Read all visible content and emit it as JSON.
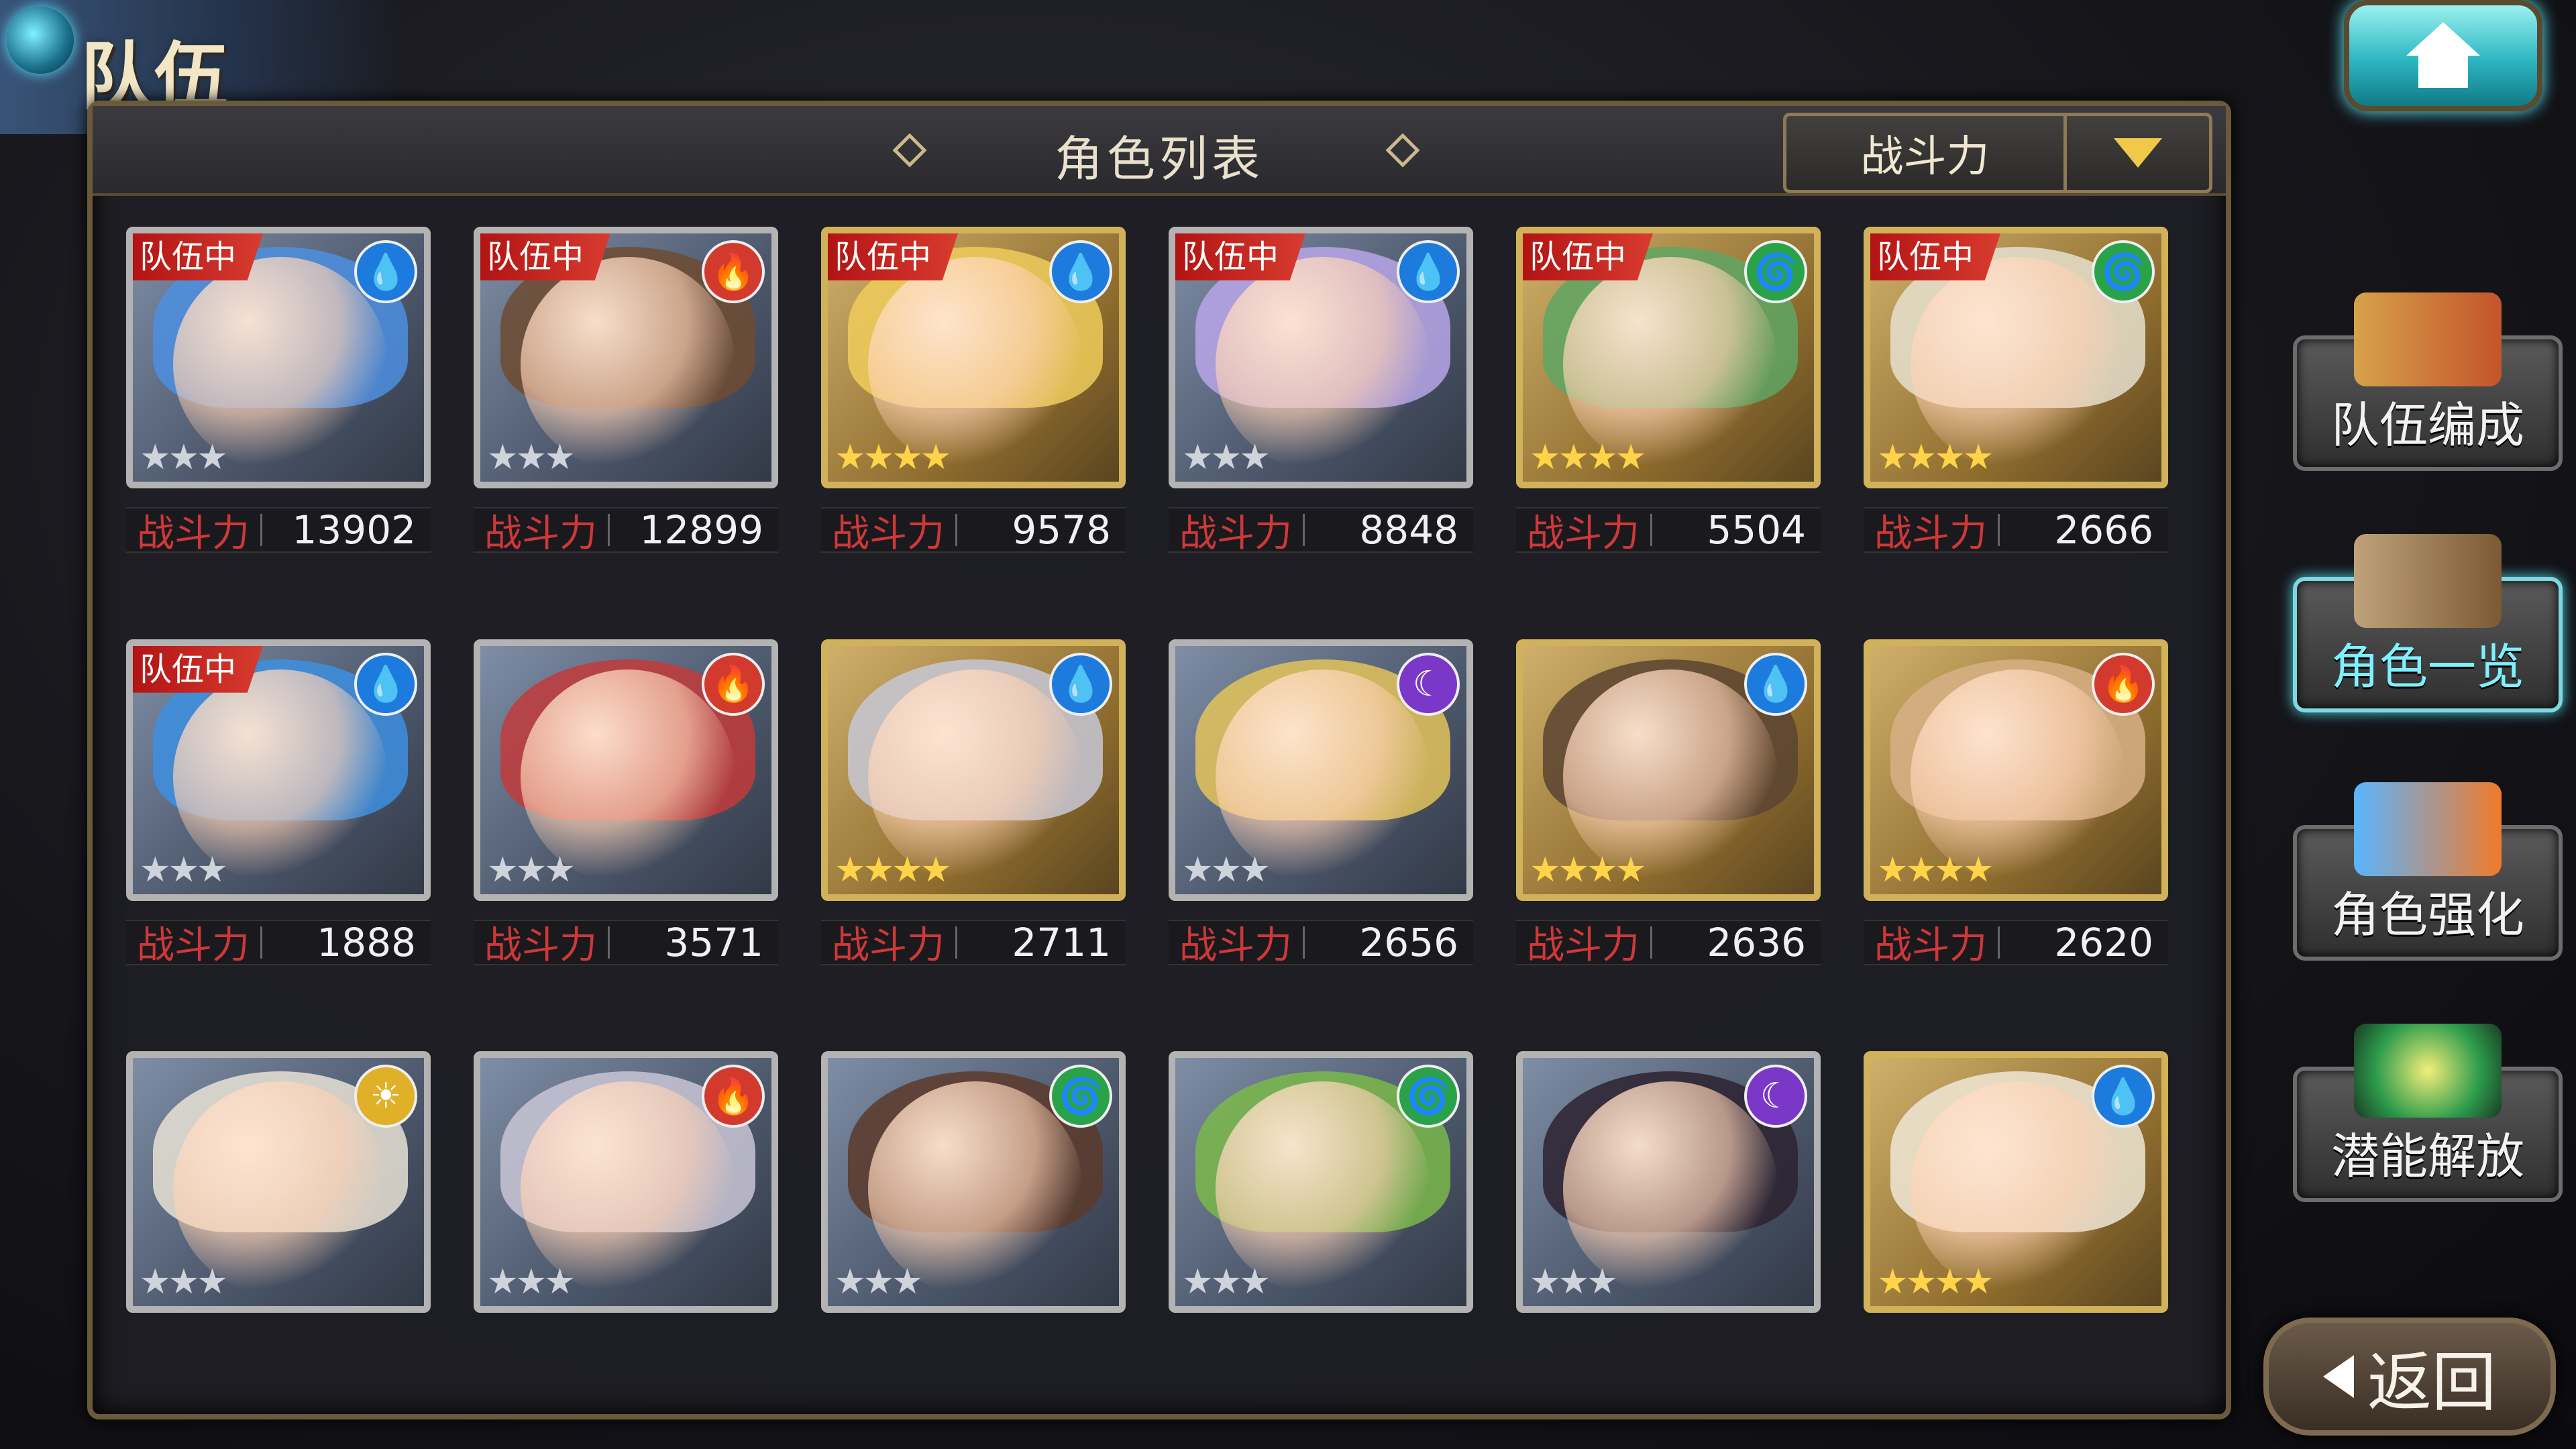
{
  "header": {
    "title": "队伍"
  },
  "panel": {
    "title": "角色列表"
  },
  "sort": {
    "label": "战斗力"
  },
  "side_menu": [
    {
      "label": "队伍编成"
    },
    {
      "label": "角色一览"
    },
    {
      "label": "角色强化"
    },
    {
      "label": "潜能解放"
    }
  ],
  "back": {
    "label": "返回"
  },
  "cards": [
    {
      "team_tag": "队伍中",
      "element": "water",
      "stars": "★★★",
      "power_label": "战斗力",
      "power": "13902"
    },
    {
      "team_tag": "队伍中",
      "element": "fire",
      "stars": "★★★",
      "power_label": "战斗力",
      "power": "12899"
    },
    {
      "team_tag": "队伍中",
      "element": "water",
      "stars": "★★★★",
      "power_label": "战斗力",
      "power": "9578"
    },
    {
      "team_tag": "队伍中",
      "element": "water",
      "stars": "★★★",
      "power_label": "战斗力",
      "power": "8848"
    },
    {
      "team_tag": "队伍中",
      "element": "wind",
      "stars": "★★★★",
      "power_label": "战斗力",
      "power": "5504"
    },
    {
      "team_tag": "队伍中",
      "element": "wind",
      "stars": "★★★★",
      "power_label": "战斗力",
      "power": "2666"
    },
    {
      "team_tag": "队伍中",
      "element": "water",
      "stars": "★★★",
      "power_label": "战斗力",
      "power": "1888"
    },
    {
      "team_tag": "",
      "element": "fire",
      "stars": "★★★",
      "power_label": "战斗力",
      "power": "3571"
    },
    {
      "team_tag": "",
      "element": "water",
      "stars": "★★★★",
      "power_label": "战斗力",
      "power": "2711"
    },
    {
      "team_tag": "",
      "element": "dark",
      "stars": "★★★",
      "power_label": "战斗力",
      "power": "2656"
    },
    {
      "team_tag": "",
      "element": "water",
      "stars": "★★★★",
      "power_label": "战斗力",
      "power": "2636"
    },
    {
      "team_tag": "",
      "element": "fire",
      "stars": "★★★★",
      "power_label": "战斗力",
      "power": "2620"
    },
    {
      "team_tag": "",
      "element": "light",
      "stars": "★★★",
      "power_label": "",
      "power": ""
    },
    {
      "team_tag": "",
      "element": "fire",
      "stars": "★★★",
      "power_label": "",
      "power": ""
    },
    {
      "team_tag": "",
      "element": "wind",
      "stars": "★★★",
      "power_label": "",
      "power": ""
    },
    {
      "team_tag": "",
      "element": "wind",
      "stars": "★★★",
      "power_label": "",
      "power": ""
    },
    {
      "team_tag": "",
      "element": "dark",
      "stars": "★★★",
      "power_label": "",
      "power": ""
    },
    {
      "team_tag": "",
      "element": "water",
      "stars": "★★★★",
      "power_label": "",
      "power": ""
    }
  ],
  "element_colors": {
    "water": "#1c7bdc",
    "fire": "#d23a2d",
    "wind": "#2aa24a",
    "dark": "#7a37c8",
    "light": "#e0b028"
  },
  "element_icons": {
    "water": "water-drop-icon",
    "fire": "fire-icon",
    "wind": "wind-swirl-icon",
    "dark": "crescent-moon-icon",
    "light": "sun-icon"
  }
}
